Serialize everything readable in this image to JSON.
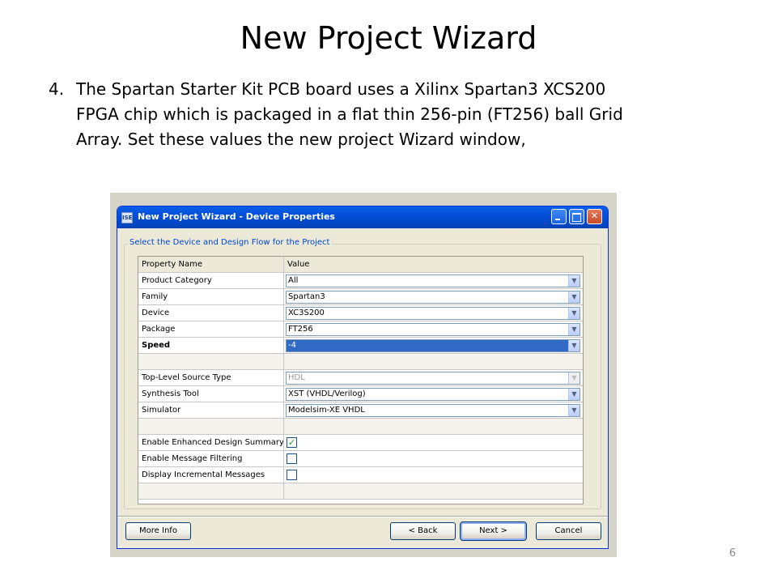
{
  "slide": {
    "title": "New Project Wizard",
    "item_number": "4.",
    "lines": [
      "The Spartan Starter Kit PCB board uses a Xilinx Spartan3 XCS200",
      "FPGA chip which is packaged in a flat thin 256-pin (FT256) ball Grid",
      "Array.  Set these values the new project Wizard window,"
    ],
    "page_number": "6"
  },
  "window": {
    "title": "New Project Wizard - Device Properties",
    "app_icon_text": "ISE",
    "group_label": "Select the Device and Design Flow for the Project",
    "grid": {
      "header": {
        "name": "Property Name",
        "value": "Value"
      },
      "rows": [
        {
          "name": "Product Category",
          "value": "All",
          "type": "combo"
        },
        {
          "name": "Family",
          "value": "Spartan3",
          "type": "combo"
        },
        {
          "name": "Device",
          "value": "XC3S200",
          "type": "combo"
        },
        {
          "name": "Package",
          "value": "FT256",
          "type": "combo"
        },
        {
          "name": "Speed",
          "value": "-4",
          "type": "combo",
          "bold": true,
          "selected": true
        },
        {
          "name": "",
          "value": "",
          "type": "blank"
        },
        {
          "name": "Top-Level Source Type",
          "value": "HDL",
          "type": "combo",
          "disabled": true
        },
        {
          "name": "Synthesis Tool",
          "value": "XST (VHDL/Verilog)",
          "type": "combo"
        },
        {
          "name": "Simulator",
          "value": "Modelsim-XE VHDL",
          "type": "combo"
        },
        {
          "name": "",
          "value": "",
          "type": "blank"
        },
        {
          "name": "Enable Enhanced Design Summary",
          "type": "check",
          "checked": true
        },
        {
          "name": "Enable Message Filtering",
          "type": "check",
          "checked": false
        },
        {
          "name": "Display Incremental Messages",
          "type": "check",
          "checked": false
        },
        {
          "name": "",
          "value": "",
          "type": "blank"
        }
      ]
    },
    "buttons": {
      "more_info": "More Info",
      "back": "< Back",
      "next": "Next >",
      "cancel": "Cancel"
    }
  },
  "colors": {
    "titlebar": "#0453dc",
    "selection": "#316ac5",
    "group_label": "#0046d5"
  },
  "icons": {
    "app": "ise-app-icon",
    "minimize": "minimize-icon",
    "maximize": "maximize-icon",
    "close": "close-icon",
    "dropdown": "chevron-down-icon",
    "check": "checkmark-icon"
  }
}
